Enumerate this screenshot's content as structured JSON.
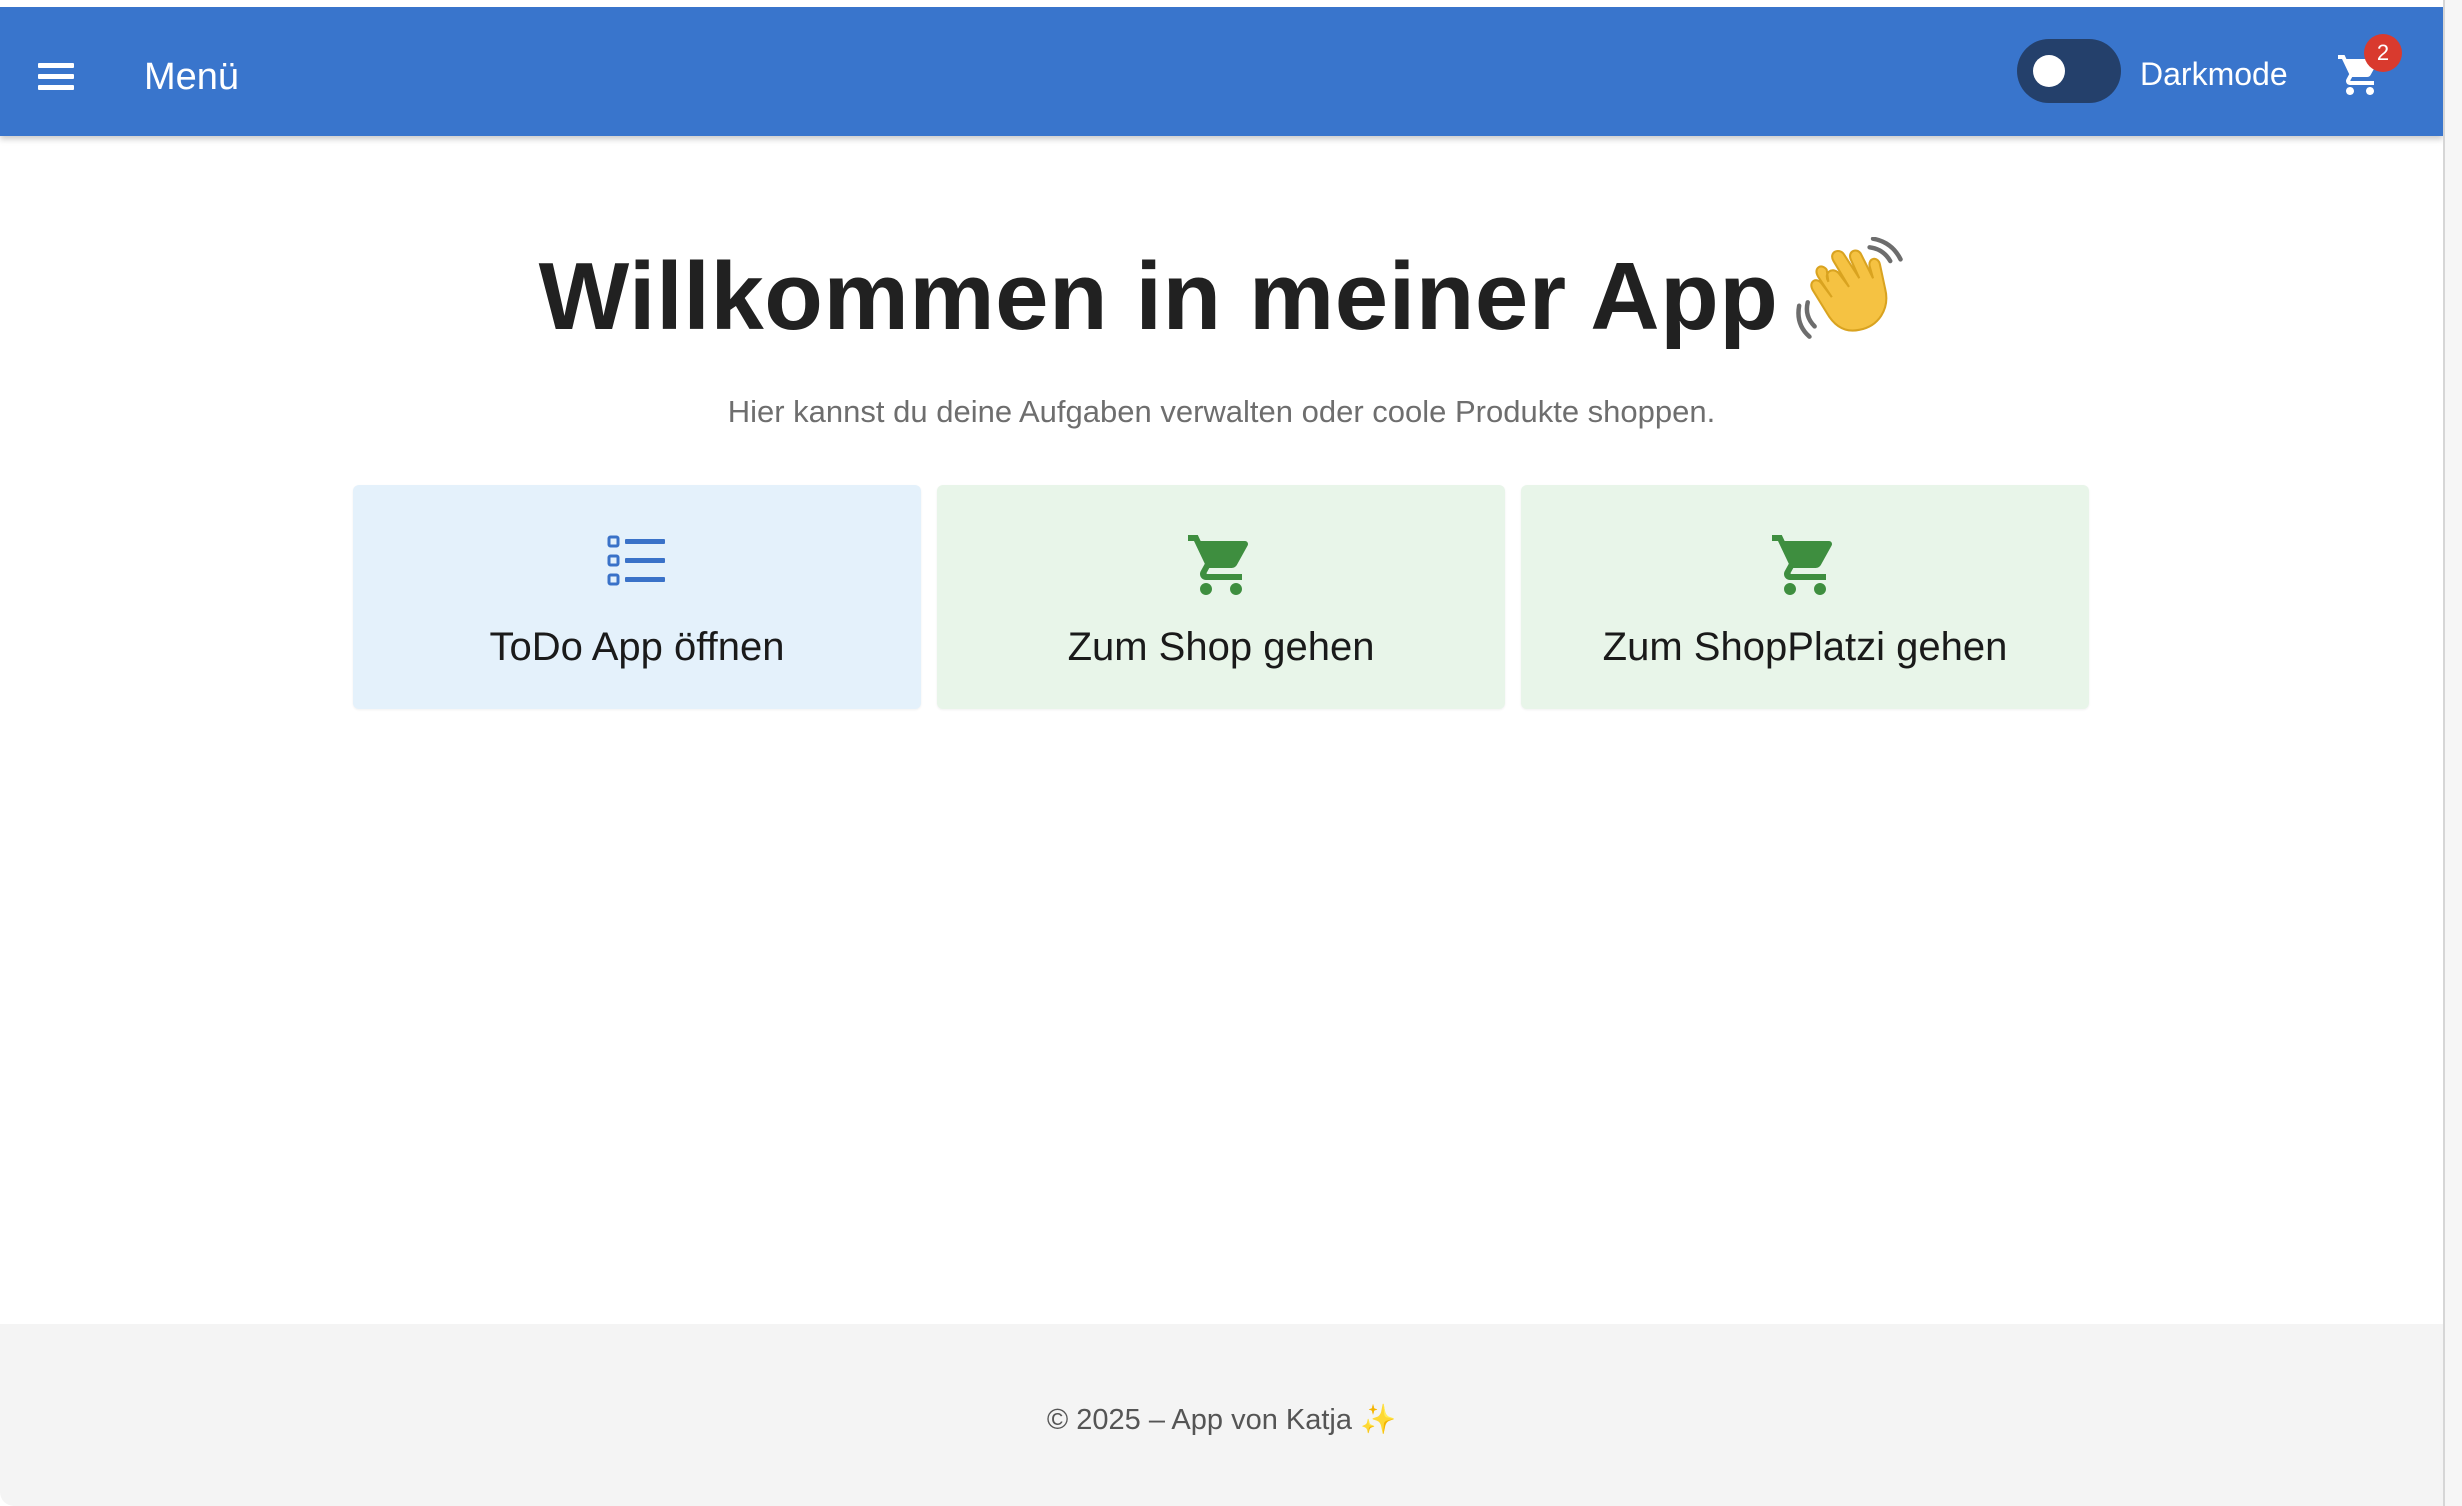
{
  "appbar": {
    "menu_label": "Menü",
    "darkmode_label": "Darkmode",
    "darkmode_on": false,
    "cart_count": "2"
  },
  "main": {
    "title": "Willkommen in meiner App",
    "title_emoji": "waving-hand-icon",
    "subtitle": "Hier kannst du deine Aufgaben verwalten oder coole Produkte shoppen.",
    "cards": [
      {
        "label": "ToDo App öffnen",
        "icon": "list-icon",
        "color": "#e4f1fb"
      },
      {
        "label": "Zum Shop gehen",
        "icon": "cart-icon",
        "color": "#e8f5e9"
      },
      {
        "label": "Zum ShopPlatzi gehen",
        "icon": "cart-icon",
        "color": "#e8f5e9"
      }
    ]
  },
  "footer": {
    "text": "© 2025 – App von Katja",
    "sparkle": "✨"
  },
  "colors": {
    "appbar": "#3975cc",
    "toggle_track": "#24406b",
    "badge": "#d93a2e",
    "list_icon": "#3a72c8",
    "cart_icon": "#3e8e3f"
  }
}
